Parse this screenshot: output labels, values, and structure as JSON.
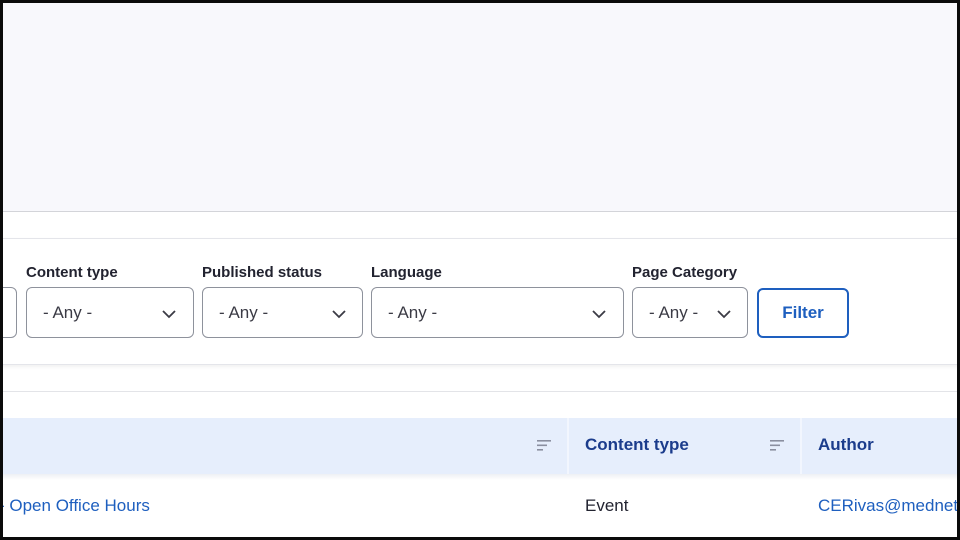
{
  "filters": [
    {
      "label": "Content type",
      "value": "- Any -"
    },
    {
      "label": "Published status",
      "value": "- Any -"
    },
    {
      "label": "Language",
      "value": "- Any -"
    },
    {
      "label": "Page Category",
      "value": "- Any -"
    }
  ],
  "filter_button": "Filter",
  "table": {
    "columns": [
      "Content type",
      "Author"
    ],
    "rows": [
      {
        "title": "- Open Office Hours",
        "content_type": "Event",
        "author": "CERivas@mednet."
      }
    ]
  },
  "colors": {
    "accent": "#1e5fbf",
    "header_bg": "#e6eefc",
    "header_text": "#1b3c8c",
    "page_bg": "#f8f8fc"
  },
  "icons": [
    "chevron-down-icon",
    "sort-icon"
  ]
}
